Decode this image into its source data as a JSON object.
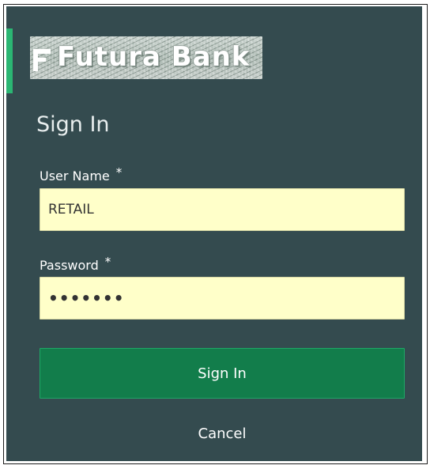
{
  "logo": {
    "text": "Futura Bank",
    "icon": "futura-bank-logo-icon"
  },
  "form": {
    "title": "Sign In",
    "username": {
      "label": "User Name",
      "required_mark": "*",
      "value": "RETAIL"
    },
    "password": {
      "label": "Password",
      "required_mark": "*",
      "value": "•••••••"
    },
    "sign_in_label": "Sign In",
    "cancel_label": "Cancel"
  },
  "colors": {
    "panel_background": "#344b4f",
    "accent": "#2bb673",
    "primary_button": "#127d4b",
    "input_background": "#ffffc9"
  }
}
